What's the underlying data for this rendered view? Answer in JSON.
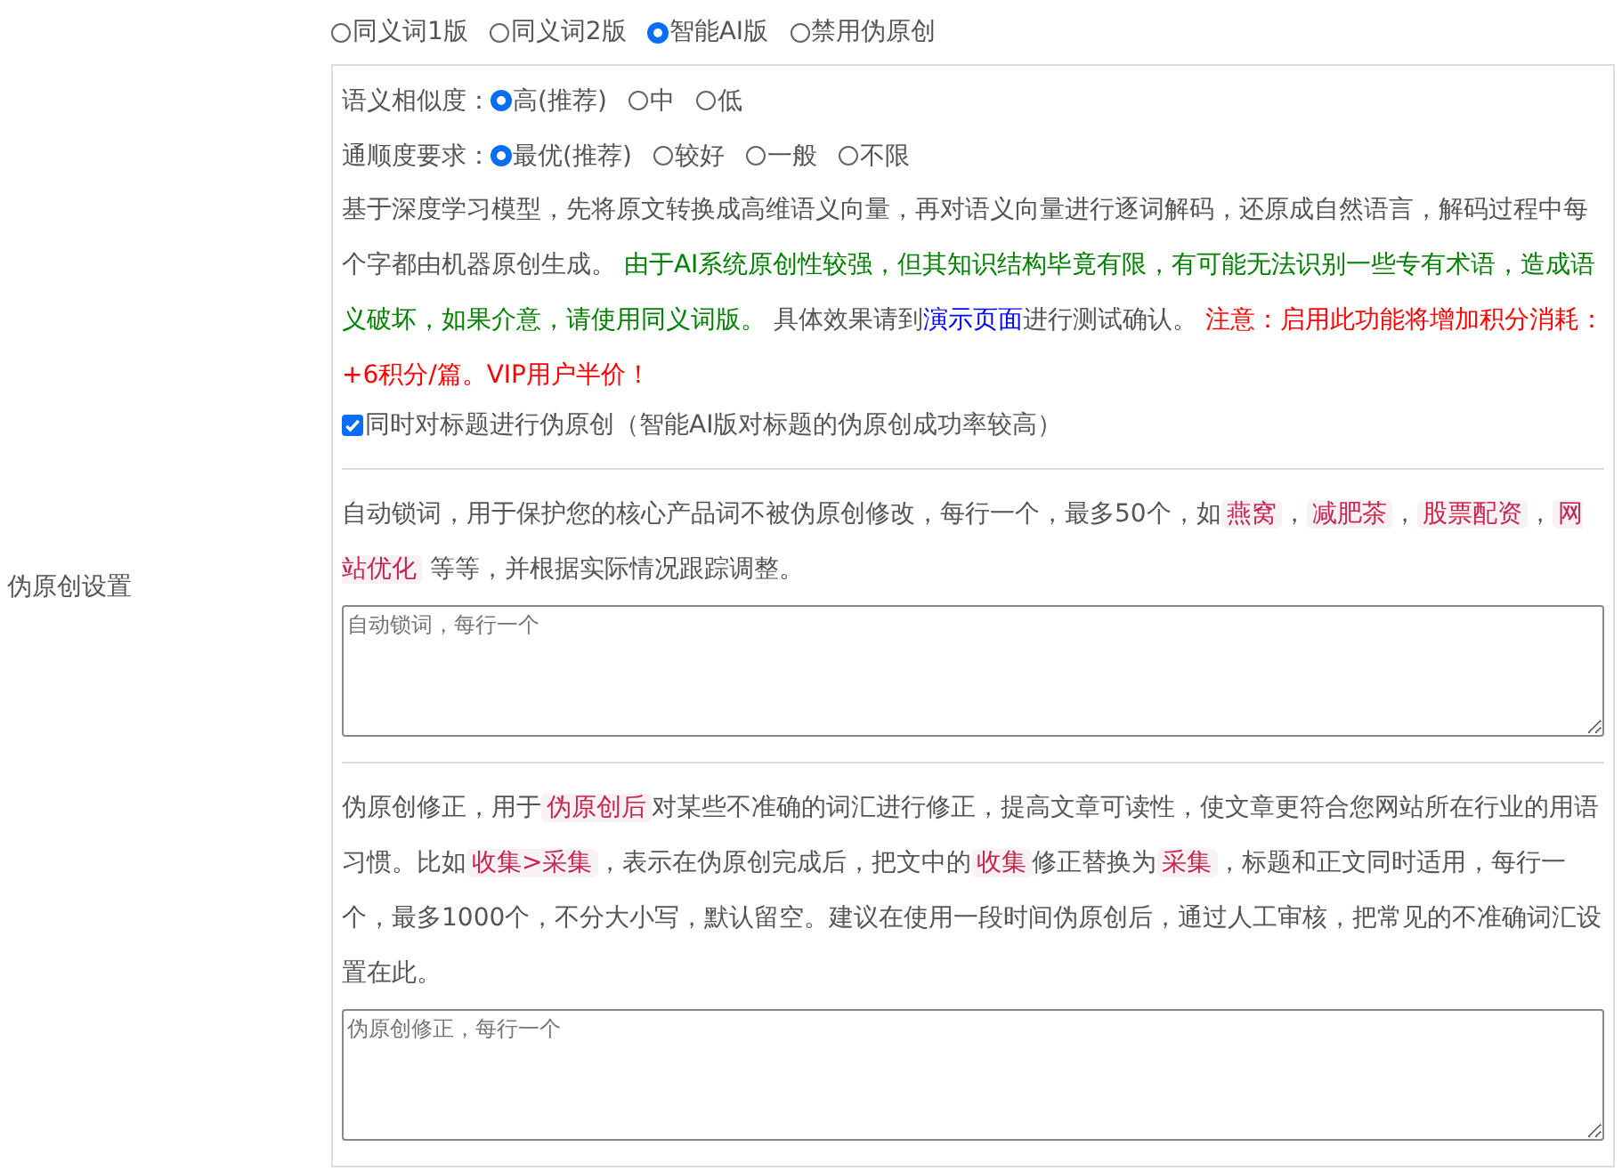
{
  "section_label": "伪原创设置",
  "modes": [
    {
      "label": "同义词1版",
      "selected": false
    },
    {
      "label": "同义词2版",
      "selected": false
    },
    {
      "label": "智能AI版",
      "selected": true
    },
    {
      "label": "禁用伪原创",
      "selected": false
    }
  ],
  "similarity": {
    "label": "语义相似度：",
    "options": [
      {
        "label": "高(推荐)",
        "selected": true
      },
      {
        "label": "中",
        "selected": false
      },
      {
        "label": "低",
        "selected": false
      }
    ]
  },
  "fluency": {
    "label": "通顺度要求：",
    "options": [
      {
        "label": "最优(推荐)",
        "selected": true
      },
      {
        "label": "较好",
        "selected": false
      },
      {
        "label": "一般",
        "selected": false
      },
      {
        "label": "不限",
        "selected": false
      }
    ]
  },
  "ai_description": [
    {
      "kind": "plain",
      "text": "基于深度学习模型，先将原文转换成高维语义向量，再对语义向量进行逐词解码，还原成自然语言，解码过程中每个字都由机器原创生成。 "
    },
    {
      "kind": "green",
      "text": "由于AI系统原创性较强，但其知识结构毕竟有限，有可能无法识别一些专有术语，造成语义破坏，如果介意，请使用同义词版。"
    },
    {
      "kind": "plain",
      "text": " 具体效果请到"
    },
    {
      "kind": "link",
      "text": "演示页面"
    },
    {
      "kind": "plain",
      "text": "进行测试确认。 "
    },
    {
      "kind": "red",
      "text": "注意：启用此功能将增加积分消耗：+6积分/篇。VIP用户半价！"
    }
  ],
  "title_checkbox": {
    "label": "同时对标题进行伪原创（智能AI版对标题的伪原创成功率较高）",
    "checked": true
  },
  "lock_words": {
    "description": [
      {
        "kind": "plain",
        "text": "自动锁词，用于保护您的核心产品词不被伪原创修改，每行一个，最多50个，如"
      },
      {
        "kind": "tag",
        "text": "燕窝"
      },
      {
        "kind": "plain",
        "text": "，"
      },
      {
        "kind": "tag",
        "text": "减肥茶"
      },
      {
        "kind": "plain",
        "text": "，"
      },
      {
        "kind": "tag",
        "text": "股票配资"
      },
      {
        "kind": "plain",
        "text": "，"
      },
      {
        "kind": "tag",
        "text": "网站优化"
      },
      {
        "kind": "plain",
        "text": " 等等，并根据实际情况跟踪调整。"
      }
    ],
    "placeholder": "自动锁词，每行一个"
  },
  "corrections": {
    "description": [
      {
        "kind": "plain",
        "text": "伪原创修正，用于"
      },
      {
        "kind": "tag",
        "text": "伪原创后"
      },
      {
        "kind": "plain",
        "text": "对某些不准确的词汇进行修正，提高文章可读性，使文章更符合您网站所在行业的用语习惯。比如"
      },
      {
        "kind": "tag",
        "text": "收集>采集"
      },
      {
        "kind": "plain",
        "text": "，表示在伪原创完成后，把文中的"
      },
      {
        "kind": "tag",
        "text": "收集"
      },
      {
        "kind": "plain",
        "text": "修正替换为"
      },
      {
        "kind": "tag",
        "text": "采集"
      },
      {
        "kind": "plain",
        "text": "，标题和正文同时适用，每行一个，最多1000个，不分大小写，默认留空。建议在使用一段时间伪原创后，通过人工审核，把常见的不准确词汇设置在此。"
      }
    ],
    "placeholder": "伪原创修正，每行一个"
  }
}
